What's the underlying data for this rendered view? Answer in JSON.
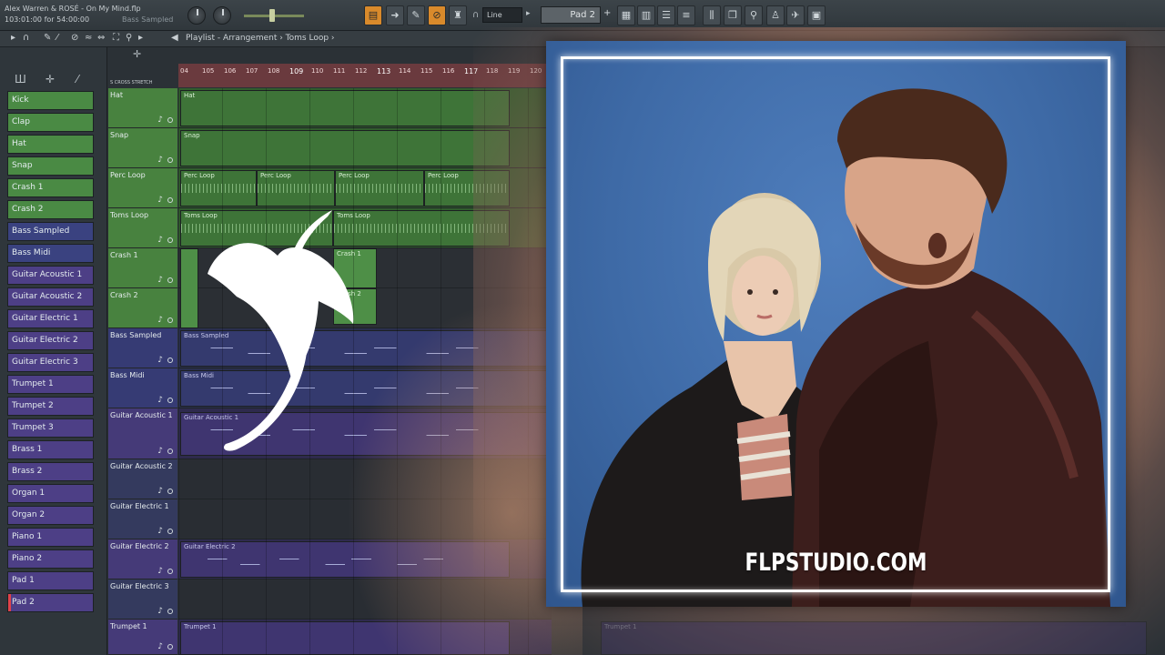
{
  "toolbar": {
    "project_title": "Alex Warren & ROSÉ - On My Mind.flp",
    "time_readout": "103:01:00 for 54:00:00",
    "hint_text": "Bass Sampled",
    "snap_value": "Line",
    "pattern_value": "Pad 2"
  },
  "breadcrumb": {
    "text": "Playlist - Arrangement › Toms Loop ›"
  },
  "channels": [
    {
      "label": "Kick",
      "color": "green"
    },
    {
      "label": "Clap",
      "color": "green"
    },
    {
      "label": "Hat",
      "color": "green"
    },
    {
      "label": "Snap",
      "color": "green"
    },
    {
      "label": "Crash 1",
      "color": "green"
    },
    {
      "label": "Crash 2",
      "color": "green"
    },
    {
      "label": "Bass Sampled",
      "color": "blue"
    },
    {
      "label": "Bass Midi",
      "color": "blue"
    },
    {
      "label": "Guitar Acoustic 1",
      "color": "purple"
    },
    {
      "label": "Guitar Acoustic 2",
      "color": "purple"
    },
    {
      "label": "Guitar Electric 1",
      "color": "purple"
    },
    {
      "label": "Guitar Electric 2",
      "color": "purple"
    },
    {
      "label": "Guitar Electric 3",
      "color": "purple"
    },
    {
      "label": "Trumpet 1",
      "color": "purple"
    },
    {
      "label": "Trumpet 2",
      "color": "purple"
    },
    {
      "label": "Trumpet 3",
      "color": "purple"
    },
    {
      "label": "Brass 1",
      "color": "purple"
    },
    {
      "label": "Brass 2",
      "color": "purple"
    },
    {
      "label": "Organ 1",
      "color": "purple"
    },
    {
      "label": "Organ 2",
      "color": "purple"
    },
    {
      "label": "Piano 1",
      "color": "purple"
    },
    {
      "label": "Piano 2",
      "color": "purple"
    },
    {
      "label": "Pad 1",
      "color": "purple"
    },
    {
      "label": "Pad 2",
      "color": "purple"
    }
  ],
  "ruler": {
    "bars": [
      "04",
      "105",
      "106",
      "107",
      "108",
      "109",
      "110",
      "111",
      "112",
      "113",
      "114",
      "115",
      "116",
      "117",
      "118",
      "119",
      "120"
    ],
    "labels": "S CROSS     STRETCH"
  },
  "tracks": [
    {
      "label": "Hat",
      "color": "green"
    },
    {
      "label": "Snap",
      "color": "green"
    },
    {
      "label": "Perc Loop",
      "color": "green"
    },
    {
      "label": "Toms Loop",
      "color": "green"
    },
    {
      "label": "Crash 1",
      "color": "green"
    },
    {
      "label": "Crash 2",
      "color": "green"
    },
    {
      "label": "Bass Sampled",
      "color": "blue"
    },
    {
      "label": "Bass Midi",
      "color": "blue"
    },
    {
      "label": "Guitar Acoustic 1",
      "color": "purple"
    },
    {
      "label": "Guitar Acoustic 2",
      "color": "dark"
    },
    {
      "label": "Guitar Electric 1",
      "color": "dark"
    },
    {
      "label": "Guitar Electric 2",
      "color": "purple"
    },
    {
      "label": "Guitar Electric 3",
      "color": "dark"
    },
    {
      "label": "Trumpet 1",
      "color": "purple"
    }
  ],
  "clips": {
    "hat": "Hat",
    "snap": "Snap",
    "perc_loop": "Perc Loop",
    "toms_loop": "Toms Loop",
    "crash_1": "Crash 1",
    "crash_2": "Crash 2",
    "bass_sampled": "Bass Sampled",
    "bass_midi": "Bass Midi",
    "guitar_acoustic_1": "Guitar Acoustic 1",
    "guitar_electric_2": "Guitar Electric 2",
    "trumpet_1": "Trumpet 1"
  },
  "artwork": {
    "watermark": "FLPSTUDIO.COM"
  }
}
